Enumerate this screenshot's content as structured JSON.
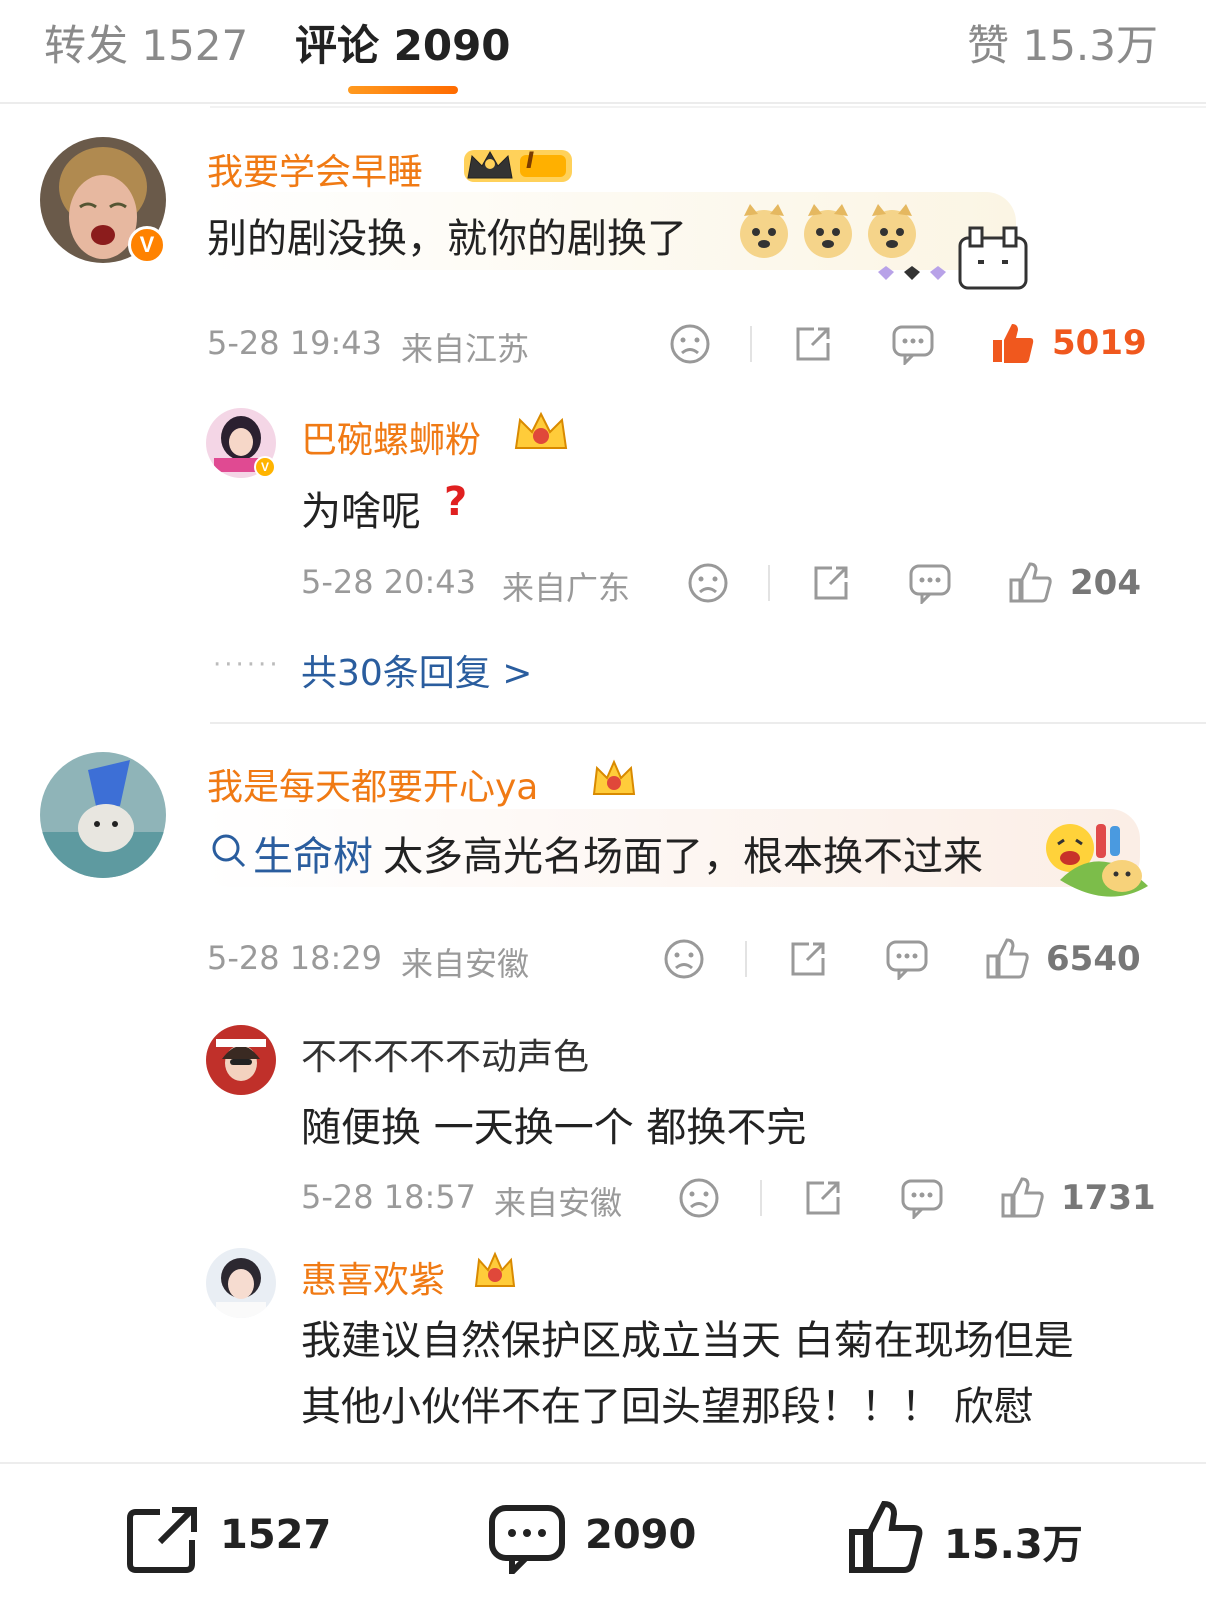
{
  "tabs": {
    "repost": "转发 1527",
    "comments": "评论 2090",
    "likes": "赞 15.3万"
  },
  "comments": [
    {
      "username": "我要学会早睡",
      "level_badge": "I",
      "text": "别的剧没换，就你的剧换了",
      "time": "5-28 19:43",
      "location": "来自江苏",
      "likes": "5019",
      "reply": {
        "username": "巴碗螺蛳粉",
        "text": "为啥呢",
        "time": "5-28 20:43",
        "location": "来自广东",
        "likes": "204"
      },
      "more_replies": "共30条回复 >"
    },
    {
      "username": "我是每天都要开心ya",
      "topic": "生命树",
      "text": "太多高光名场面了，根本换不过来",
      "time": "5-28 18:29",
      "location": "来自安徽",
      "likes": "6540",
      "replies": [
        {
          "username": "不不不不不动声色",
          "text": "随便换 一天换一个 都换不完",
          "time": "5-28 18:57",
          "location": "来自安徽",
          "likes": "1731"
        },
        {
          "username": "惠喜欢紫",
          "text": "我建议自然保护区成立当天 白菊在现场但是其他小伙伴不在了回头望那段！！！ 欣慰"
        }
      ]
    }
  ],
  "bottom_bar": {
    "reposts": "1527",
    "comments": "2090",
    "likes": "15.3万"
  },
  "colors": {
    "brand_orange": "#ff8200",
    "username_orange": "#f07a14",
    "like_red": "#f0581e",
    "link_blue": "#2a5d9e"
  }
}
